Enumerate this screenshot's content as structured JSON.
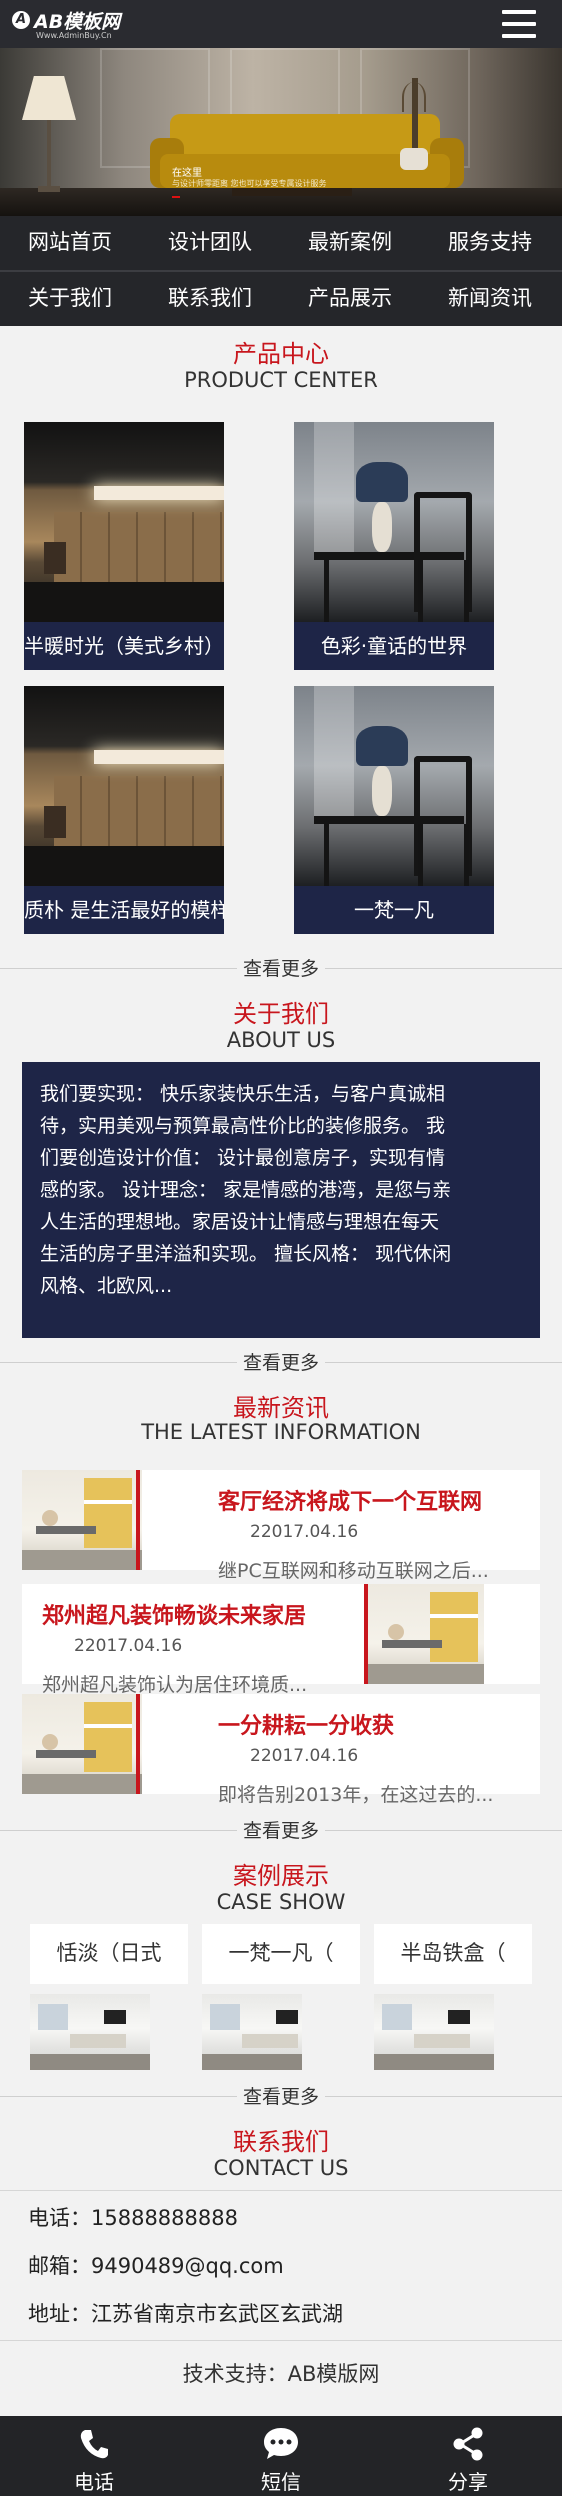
{
  "header": {
    "logo_mark": "A",
    "logo_main": "AB模板网",
    "logo_sub": "Www.AdminBuy.Cn"
  },
  "banner": {
    "line1": "在这里",
    "line2": "与设计师零距离 您也可以享受专属设计服务"
  },
  "nav": {
    "items": [
      "网站首页",
      "设计团队",
      "最新案例",
      "服务支持",
      "关于我们",
      "联系我们",
      "产品展示",
      "新闻资讯"
    ]
  },
  "products": {
    "title_cn": "产品中心",
    "title_en": "PRODUCT CENTER",
    "items": [
      {
        "caption": "半暖时光（美式乡村）"
      },
      {
        "caption": "色彩·童话的世界"
      },
      {
        "caption": "质朴 是生活最好的模样"
      },
      {
        "caption": "一梵一凡"
      }
    ],
    "more": "查看更多"
  },
  "about": {
    "title_cn": "关于我们",
    "title_en": "ABOUT US",
    "lines": [
      "我们要实现： 快乐家装快乐生活，与客户真诚相",
      "待，实用美观与预算最高性价比的装修服务。 我",
      "们要创造设计价值： 设计最创意房子，实现有情",
      "感的家。 设计理念： 家是情感的港湾，是您与亲",
      "人生活的理想地。家居设计让情感与理想在每天",
      "生活的房子里洋溢和实现。 擅长风格： 现代休闲",
      "风格、北欧风..."
    ],
    "more": "查看更多"
  },
  "news": {
    "title_cn": "最新资讯",
    "title_en": "THE LATEST INFORMATION",
    "items": [
      {
        "title": "客厅经济将成下一个互联网",
        "date": "22017.04.16",
        "summary": "继PC互联网和移动互联网之后..."
      },
      {
        "title": "郑州超凡装饰畅谈未来家居",
        "date": "22017.04.16",
        "summary": "郑州超凡装饰认为居住环境质..."
      },
      {
        "title": "一分耕耘一分收获",
        "date": "22017.04.16",
        "summary": "即将告别2013年，在这过去的..."
      }
    ],
    "more": "查看更多"
  },
  "cases": {
    "title_cn": "案例展示",
    "title_en": "CASE SHOW",
    "items": [
      {
        "label": "恬淡（日式"
      },
      {
        "label": "一梵一凡（"
      },
      {
        "label": "半岛铁盒（"
      }
    ],
    "more": "查看更多"
  },
  "contact": {
    "title_cn": "联系我们",
    "title_en": "CONTACT US",
    "phone": "电话：15888888888",
    "email": "邮箱：9490489@qq.com",
    "address": "地址：江苏省南京市玄武区玄武湖"
  },
  "footer": {
    "support": "技术支持：AB模版网"
  },
  "bottom_nav": {
    "items": [
      {
        "label": "电话",
        "icon": "phone-icon"
      },
      {
        "label": "短信",
        "icon": "sms-icon"
      },
      {
        "label": "分享",
        "icon": "share-icon"
      }
    ]
  },
  "colors": {
    "accent_red": "#c8161d",
    "navy": "#1e2547",
    "header_dark": "#2a2b30"
  }
}
